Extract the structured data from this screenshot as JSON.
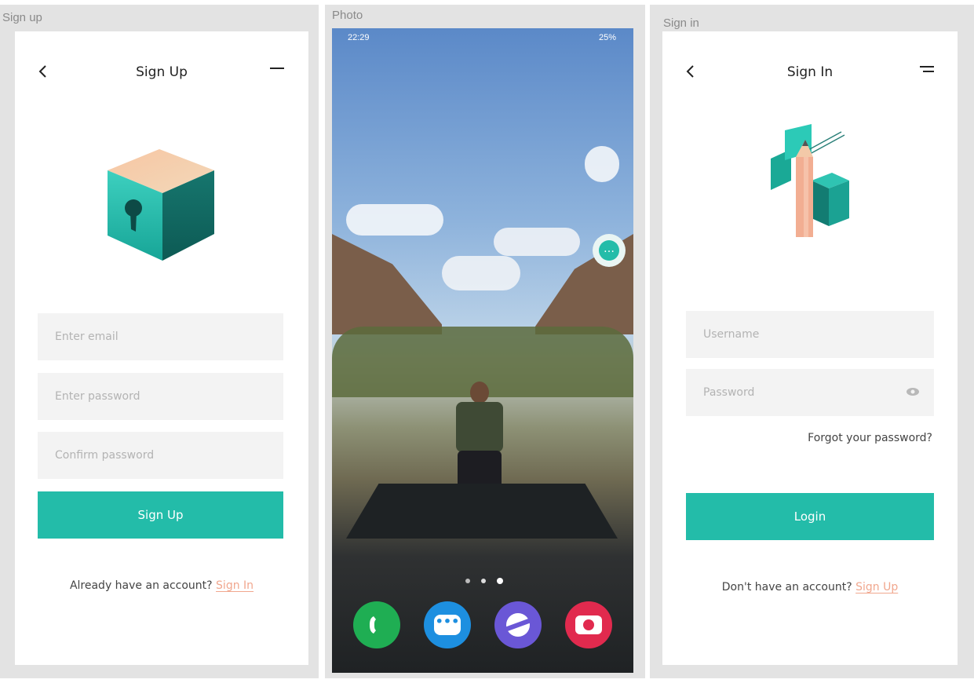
{
  "artboards": {
    "signup": {
      "label": "Sign up",
      "nav": {
        "back_icon": "chevron-left-icon",
        "title": "Sign Up",
        "menu_icon": "menu-icon"
      },
      "fields": {
        "email_placeholder": "Enter email",
        "password_placeholder": "Enter password",
        "confirm_placeholder": "Confirm password"
      },
      "button": "Sign Up",
      "footer": {
        "text": "Already have an account?",
        "link": "Sign In"
      }
    },
    "photo": {
      "label": "Photo",
      "status": {
        "time": "22:29",
        "battery": "25%"
      },
      "dock": [
        "phone-icon",
        "messages-icon",
        "internet-icon",
        "camera-icon"
      ]
    },
    "signin": {
      "label": "Sign in",
      "nav": {
        "back_icon": "chevron-left-icon",
        "title": "Sign In",
        "menu_icon": "menu-icon"
      },
      "fields": {
        "username_placeholder": "Username",
        "password_placeholder": "Password"
      },
      "forgot": "Forgot your password?",
      "button": "Login",
      "footer": {
        "text": "Don't have an account?",
        "link": "Sign Up"
      }
    }
  },
  "colors": {
    "accent": "#23bca9",
    "link": "#f1a78e",
    "artboard_bg": "#e3e3e3"
  }
}
